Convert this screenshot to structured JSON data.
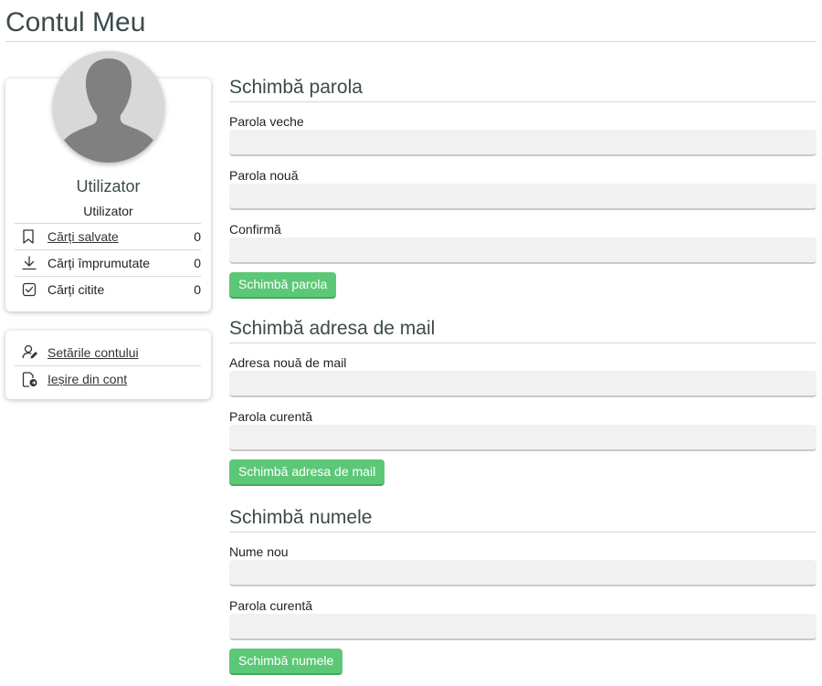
{
  "page": {
    "title": "Contul Meu"
  },
  "profile": {
    "name": "Utilizator",
    "role": "Utilizator",
    "stats": [
      {
        "label": "Cărți salvate",
        "count": "0",
        "icon": "bookmark-icon",
        "link": true
      },
      {
        "label": "Cărți împrumutate",
        "count": "0",
        "icon": "download-icon",
        "link": false
      },
      {
        "label": "Cărți citite",
        "count": "0",
        "icon": "checkbox-icon",
        "link": false
      }
    ]
  },
  "settings": {
    "items": [
      {
        "label": "Setările contului",
        "icon": "user-edit-icon"
      },
      {
        "label": "Ieșire din cont",
        "icon": "logout-icon"
      }
    ]
  },
  "password_section": {
    "title": "Schimbă parola",
    "old_label": "Parola veche",
    "new_label": "Parola nouă",
    "confirm_label": "Confirmă",
    "button": "Schimbă parola"
  },
  "email_section": {
    "title": "Schimbă adresa de mail",
    "email_label": "Adresa nouă de mail",
    "password_label": "Parola curentă",
    "button": "Schimbă adresa de mail"
  },
  "name_section": {
    "title": "Schimbă numele",
    "name_label": "Nume nou",
    "password_label": "Parola curentă",
    "button": "Schimbă numele"
  },
  "colors": {
    "accent": "#5cc877",
    "heading": "#3d4a4a",
    "input_bg": "#f1f1f1"
  }
}
